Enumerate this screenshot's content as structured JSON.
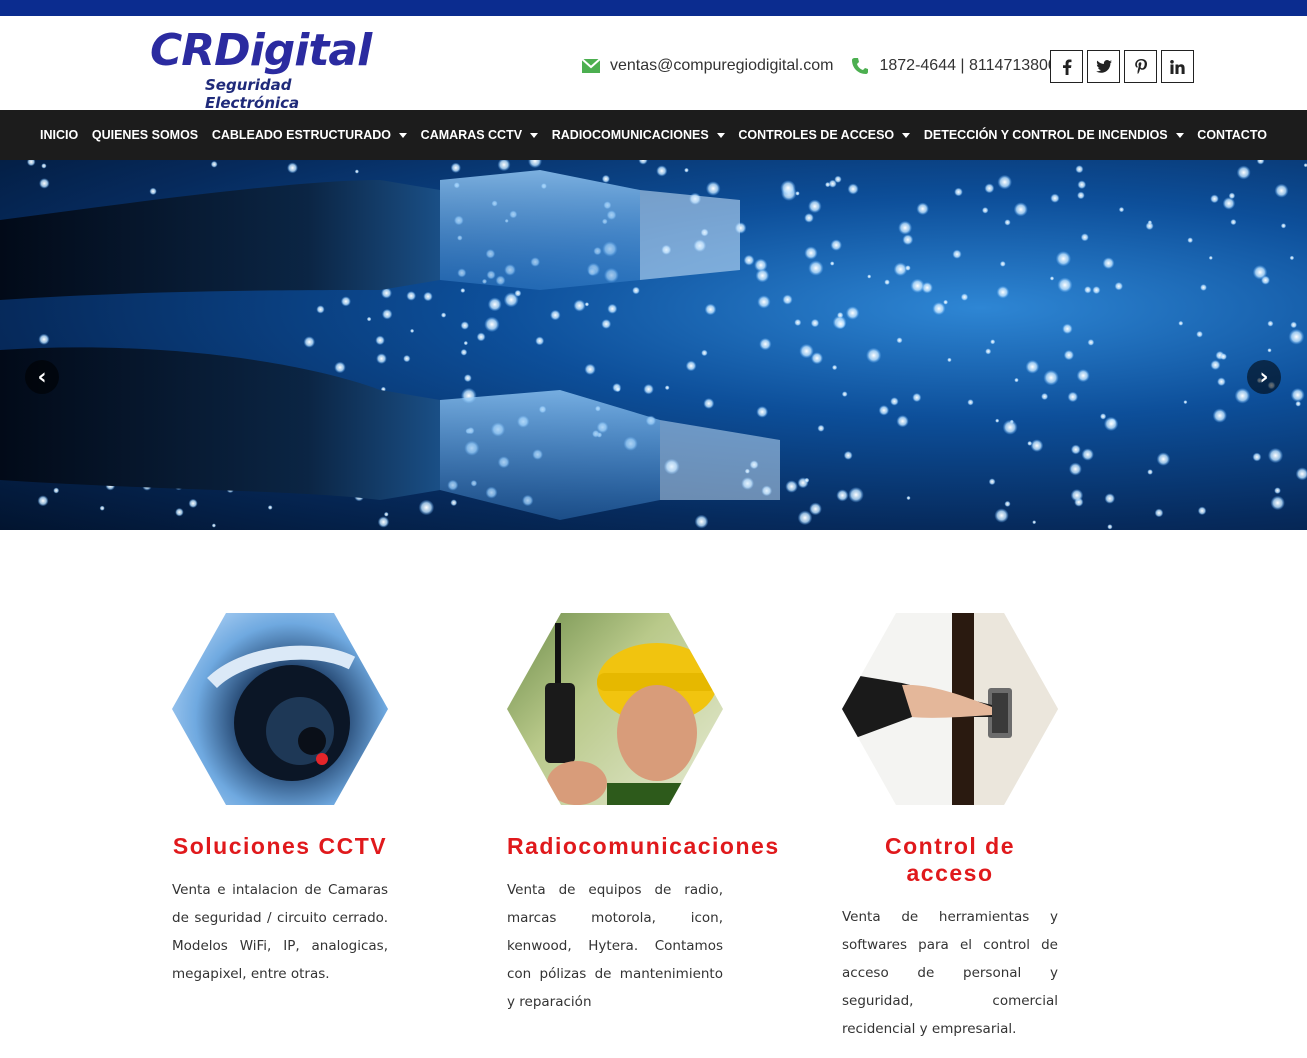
{
  "logo": {
    "main": "CRDigital",
    "sub": "Seguridad Electrónica"
  },
  "contact": {
    "email_icon": "envelope-icon",
    "email": "ventas@compuregiodigital.com",
    "phone_icon": "phone-icon",
    "phone": "1872-4644 | 8114713800"
  },
  "social": [
    {
      "icon": "facebook-icon",
      "glyph": "f"
    },
    {
      "icon": "twitter-icon",
      "glyph": "t"
    },
    {
      "icon": "pinterest-icon",
      "glyph": "p"
    },
    {
      "icon": "linkedin-icon",
      "glyph": "in"
    }
  ],
  "nav": [
    {
      "label": "INICIO",
      "dropdown": false
    },
    {
      "label": "QUIENES SOMOS",
      "dropdown": false
    },
    {
      "label": "CABLEADO ESTRUCTURADO",
      "dropdown": true
    },
    {
      "label": "CAMARAS CCTV",
      "dropdown": true
    },
    {
      "label": "RADIOCOMUNICACIONES",
      "dropdown": true
    },
    {
      "label": "CONTROLES DE ACCESO",
      "dropdown": true
    },
    {
      "label": "DETECCIÓN Y CONTROL DE INCENDIOS",
      "dropdown": true
    },
    {
      "label": "CONTACTO",
      "dropdown": false
    }
  ],
  "slider": {
    "prev_icon": "chevron-left-icon",
    "next_icon": "chevron-right-icon",
    "prev": "‹",
    "next": "›"
  },
  "features": [
    {
      "title": "Soluciones CCTV",
      "text": "Venta e intalacion de Camaras de seguridad / circuito cerrado. Modelos WiFi, IP, analogicas, megapixel, entre otras."
    },
    {
      "title": "Radiocomunicaciones",
      "text": "Venta de equipos de radio, marcas motorola, icon, kenwood, Hytera. Contamos con pólizas de mantenimiento y reparación"
    },
    {
      "title": "Control de acceso",
      "text": "Venta de herramientas y softwares para el control de acceso de personal y seguridad, comercial recidencial y empresarial."
    }
  ],
  "colors": {
    "topbar": "#0b2c8f",
    "nav_bg": "#1c1c1c",
    "accent_red": "#e0191c",
    "icon_green": "#4caf50"
  }
}
